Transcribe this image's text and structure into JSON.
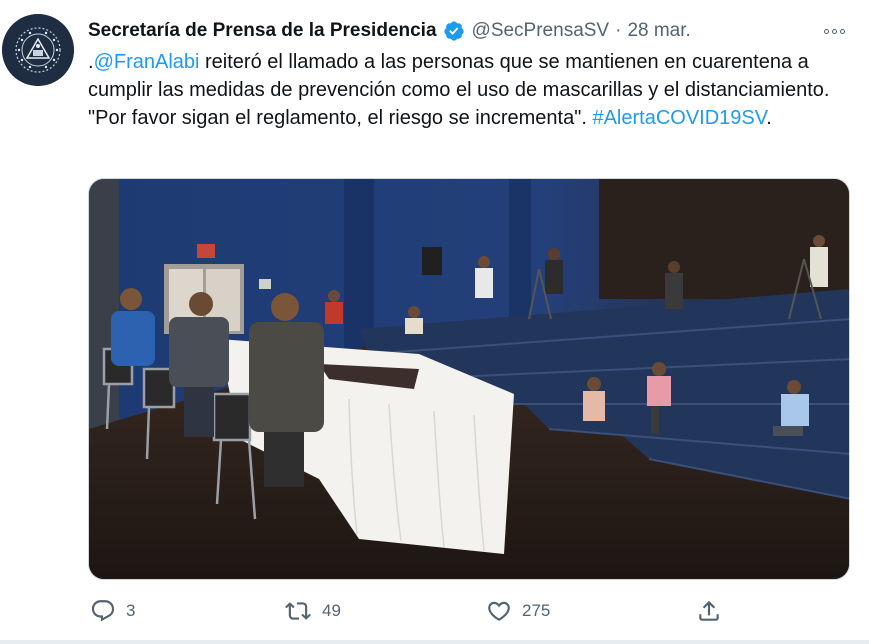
{
  "tweet": {
    "author_name": "Secretaría de Prensa de la Presidencia",
    "handle": "@SecPrensaSV",
    "separator": "·",
    "date": "28 mar.",
    "text": {
      "lead": ".",
      "mention": "@FranAlabi",
      "body": " reiteró el llamado a las personas que se mantienen en cuarentena a cumplir las medidas de prevención como el uso de mascarillas y el distanciamiento. \"Por favor sigan el reglamento, el riesgo se incrementa\". ",
      "hashtag": "#AlertaCOVID19SV",
      "tail": "."
    },
    "actions": {
      "reply_count": "3",
      "retweet_count": "49",
      "like_count": "275"
    },
    "colors": {
      "link": "#1d9bf0",
      "secondary_text": "#536471",
      "verified": "#1d9bf0",
      "avatar_bg": "#1f2d43"
    },
    "icons": [
      "verified-badge-icon",
      "more-options-icon",
      "reply-icon",
      "retweet-icon",
      "like-icon",
      "share-icon",
      "government-seal-logo"
    ]
  }
}
